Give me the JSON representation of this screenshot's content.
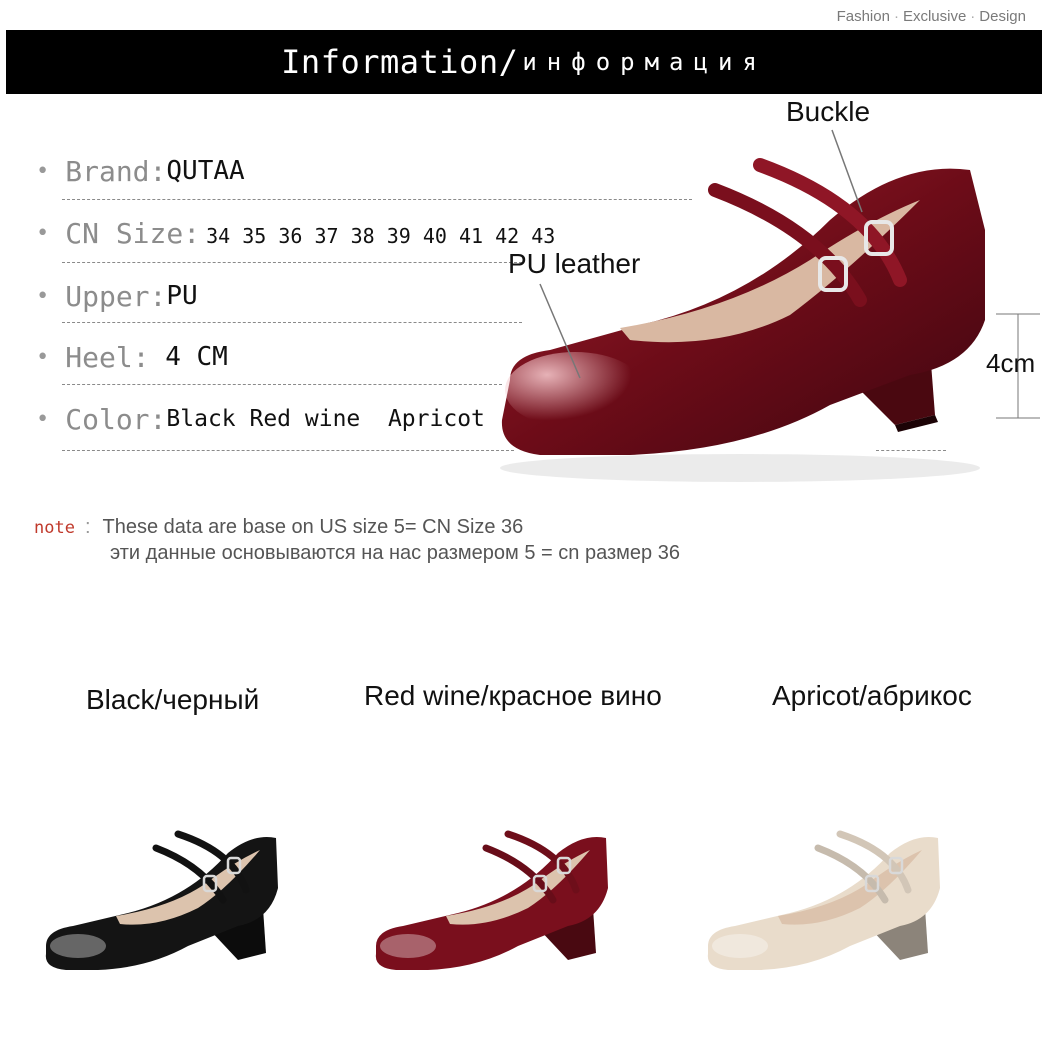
{
  "tagline": [
    "Fashion",
    "Exclusive",
    "Design"
  ],
  "banner": {
    "title": "Information/",
    "subtitle": "информация"
  },
  "specs": [
    {
      "label": "Brand:",
      "value": "QUTAA"
    },
    {
      "label": "CN Size:",
      "value": "34 35 36 37 38 39 40 41 42 43"
    },
    {
      "label": "Upper: ",
      "value": "PU"
    },
    {
      "label": "Heel: ",
      "value": " 4 CM"
    },
    {
      "label": "Color: ",
      "value": "Black Red wine  Apricot"
    }
  ],
  "callouts": {
    "buckle": "Buckle",
    "material": "PU leather",
    "heel_height": "4cm"
  },
  "note": {
    "tag": "note",
    "colon": ":",
    "line_en": "These data are base on US size 5= CN Size 36",
    "line_ru": "эти данные основываются на нас размером 5 = cn размер 36"
  },
  "colors": [
    {
      "label": "Black/черный",
      "hex": "#141414"
    },
    {
      "label": "Red wine/красное вино",
      "hex": "#7a0f1d"
    },
    {
      "label": "Apricot/абрикос",
      "hex": "#e9dccb"
    }
  ]
}
